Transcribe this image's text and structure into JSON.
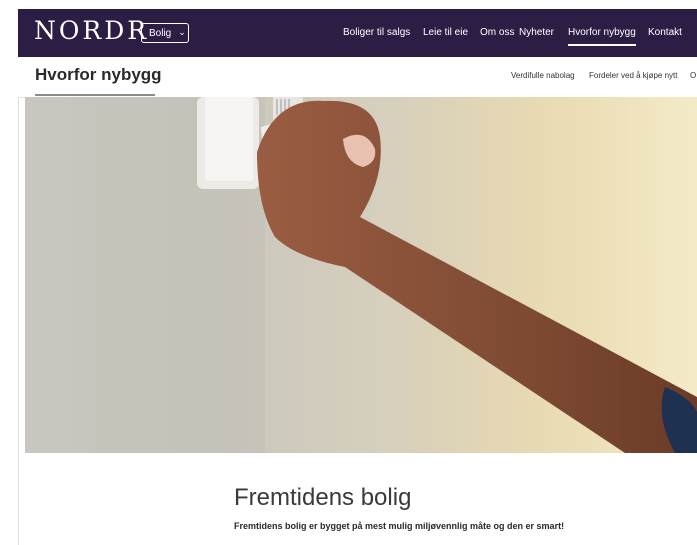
{
  "header": {
    "logo": "NORDR",
    "category_select": {
      "value": "Bolig"
    },
    "nav": [
      {
        "label": "Boliger til salgs",
        "active": false
      },
      {
        "label": "Leie til eie",
        "active": false
      },
      {
        "label": "Om oss",
        "active": false
      },
      {
        "label": "Nyheter",
        "active": false
      },
      {
        "label": "Hvorfor nybygg",
        "active": true
      },
      {
        "label": "Kontakt",
        "active": false
      }
    ]
  },
  "subnav": {
    "title": "Hvorfor nybygg",
    "links": [
      {
        "label": "Verdifulle nabolag"
      },
      {
        "label": "Fordeler ved å kjøpe nytt"
      },
      {
        "label": "O"
      }
    ]
  },
  "hero": {
    "icon": "hero-image-hand-on-wall-switch"
  },
  "content": {
    "title": "Fremtidens bolig",
    "lead": "Fremtidens bolig er bygget på mest mulig miljøvennlig måte og den er smart!"
  },
  "colors": {
    "header_bg": "#2c1d44",
    "text_dark": "#2a2a2a"
  }
}
